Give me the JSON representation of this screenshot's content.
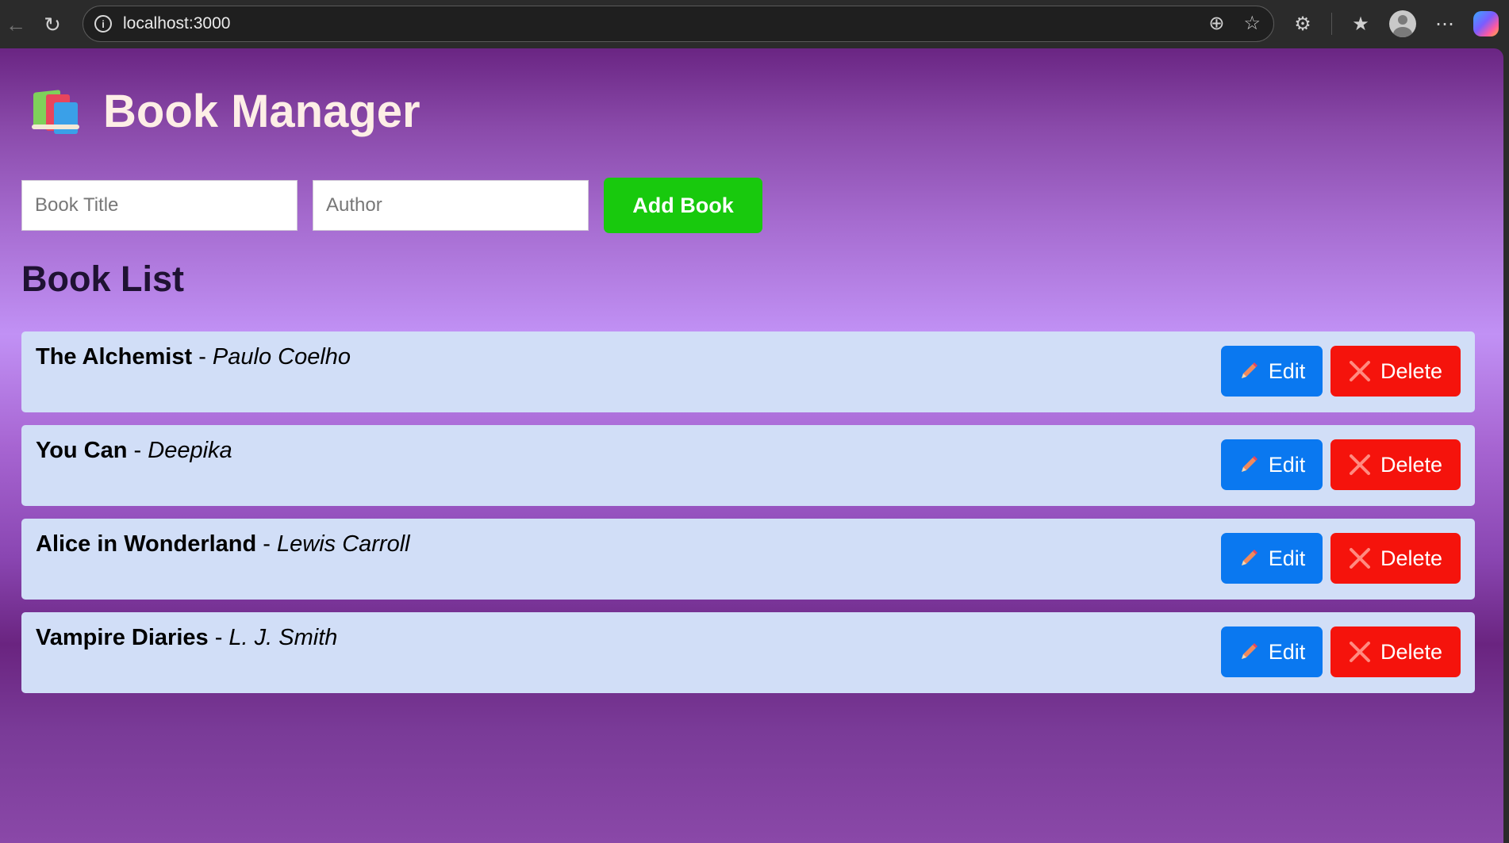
{
  "browser": {
    "url": "localhost:3000"
  },
  "app": {
    "title": "Book Manager",
    "form": {
      "title_placeholder": "Book Title",
      "author_placeholder": "Author",
      "title_value": "",
      "author_value": "",
      "add_label": "Add Book"
    },
    "list_heading": "Book List",
    "edit_label": "Edit",
    "delete_label": "Delete",
    "separator": " - ",
    "books": [
      {
        "title": "The Alchemist",
        "author": "Paulo Coelho"
      },
      {
        "title": "You Can",
        "author": "Deepika"
      },
      {
        "title": "Alice in Wonderland",
        "author": "Lewis Carroll"
      },
      {
        "title": "Vampire Diaries",
        "author": "L. J. Smith"
      }
    ]
  },
  "colors": {
    "add_button": "#18c90d",
    "edit_button": "#0a78f0",
    "delete_button": "#f5130c",
    "list_item_bg": "#d1def7"
  }
}
